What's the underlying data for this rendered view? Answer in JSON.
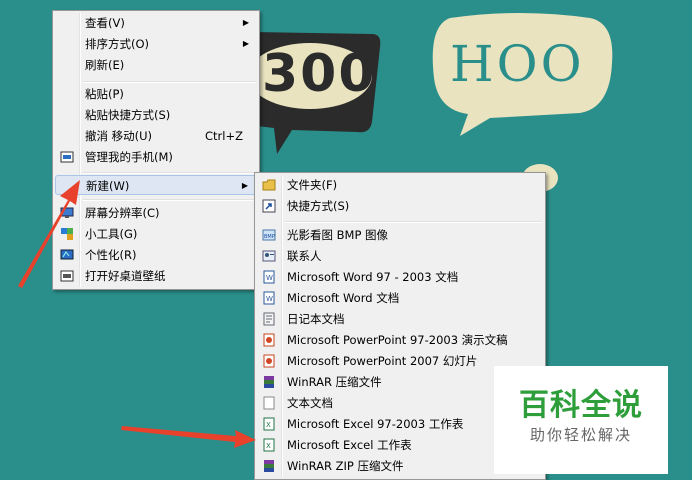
{
  "background": {
    "bubble_text_1": "300",
    "bubble_text_2": "HOO"
  },
  "context_menu": {
    "items": [
      {
        "label": "查看(V)",
        "submenu": true
      },
      {
        "label": "排序方式(O)",
        "submenu": true
      },
      {
        "label": "刷新(E)"
      },
      {
        "label": "粘贴(P)"
      },
      {
        "label": "粘贴快捷方式(S)"
      },
      {
        "label": "撤消 移动(U)",
        "shortcut": "Ctrl+Z"
      },
      {
        "label": "管理我的手机(M)",
        "icon": "phone-manager-icon"
      },
      {
        "label": "新建(W)",
        "submenu": true,
        "highlighted": true
      },
      {
        "label": "屏幕分辨率(C)",
        "icon": "display-icon"
      },
      {
        "label": "小工具(G)",
        "icon": "gadgets-icon"
      },
      {
        "label": "个性化(R)",
        "icon": "personalize-icon"
      },
      {
        "label": "打开好桌道壁纸",
        "icon": "wallpaper-icon"
      }
    ]
  },
  "new_submenu": {
    "items": [
      {
        "label": "文件夹(F)",
        "icon": "folder-icon"
      },
      {
        "label": "快捷方式(S)",
        "icon": "shortcut-icon"
      },
      {
        "label": "光影看图 BMP 图像",
        "icon": "bmp-image-icon"
      },
      {
        "label": "联系人",
        "icon": "contact-icon"
      },
      {
        "label": "Microsoft Word 97 - 2003 文档",
        "icon": "word-doc-icon"
      },
      {
        "label": "Microsoft Word 文档",
        "icon": "word-docx-icon"
      },
      {
        "label": "日记本文档",
        "icon": "journal-icon"
      },
      {
        "label": "Microsoft PowerPoint 97-2003 演示文稿",
        "icon": "ppt-icon"
      },
      {
        "label": "Microsoft PowerPoint 2007 幻灯片",
        "icon": "pptx-icon"
      },
      {
        "label": "WinRAR 压缩文件",
        "icon": "winrar-icon"
      },
      {
        "label": "文本文档",
        "icon": "text-doc-icon"
      },
      {
        "label": "Microsoft Excel 97-2003 工作表",
        "icon": "xls-icon"
      },
      {
        "label": "Microsoft Excel 工作表",
        "icon": "xlsx-icon"
      },
      {
        "label": "WinRAR ZIP 压缩文件",
        "icon": "winrar-zip-icon"
      }
    ]
  },
  "watermark": {
    "title": "百科全说",
    "subtitle": "助你轻松解决"
  },
  "colors": {
    "desktop_bg": "#2a8f8b",
    "bubble": "#e9e3bf",
    "bubble_dark": "#2b2b2b",
    "annotation_arrow": "#e8422d",
    "watermark_green": "#2e9e3a"
  }
}
